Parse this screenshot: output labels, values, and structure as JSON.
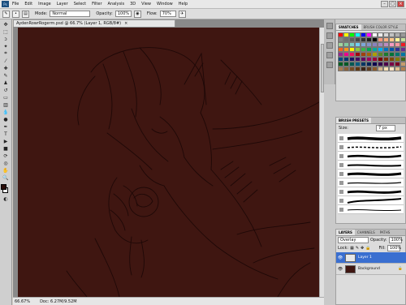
{
  "menu": {
    "app_icon": "Ps",
    "items": [
      "File",
      "Edit",
      "Image",
      "Layer",
      "Select",
      "Filter",
      "Analysis",
      "3D",
      "View",
      "Window",
      "Help"
    ]
  },
  "window_buttons": {
    "minimize": "–",
    "maximize": "▢",
    "close": "×"
  },
  "options_bar": {
    "mode_label": "Mode:",
    "mode_value": "Normal",
    "opacity_label": "Opacity:",
    "opacity_value": "100%",
    "flow_label": "Flow:",
    "flow_value": "70%"
  },
  "document": {
    "tab_title": "AydenRowrRogerm.psd @ 66.7% (Layer 1, RGB/8#)",
    "tab_close": "×",
    "zoom": "66.67%",
    "doc_info": "Doc: 6.27M/9.52M"
  },
  "colors": {
    "canvas_bg": "#3f1611",
    "sketch_line": "#1e0807",
    "foreground": "#2a0c08",
    "background": "#ffffff",
    "layer_highlight": "#3a6fd0"
  },
  "swatches_panel": {
    "tabs": [
      "SWATCHES",
      "BRUSH COLOR STYLE"
    ],
    "colors": [
      "#ff0000",
      "#ffff00",
      "#00ff00",
      "#00ffff",
      "#0000ff",
      "#ff00ff",
      "#ffffff",
      "#ebebeb",
      "#d6d6d6",
      "#c2c2c2",
      "#adadad",
      "#999999",
      "#858585",
      "#707070",
      "#5c5c5c",
      "#474747",
      "#333333",
      "#1f1f1f",
      "#000000",
      "#f7977a",
      "#f9ad81",
      "#fdc68a",
      "#fff79a",
      "#c4df9b",
      "#a2d39c",
      "#82ca9d",
      "#7bcdc8",
      "#6ecff6",
      "#7ea7d8",
      "#8493ca",
      "#8882be",
      "#a187be",
      "#bc8dbf",
      "#f49ac2",
      "#f6989d",
      "#ed1c24",
      "#f26522",
      "#f7941d",
      "#fff200",
      "#8dc63f",
      "#39b54a",
      "#00a651",
      "#00a99d",
      "#00aeef",
      "#0072bc",
      "#0054a6",
      "#2e3192",
      "#662d91",
      "#92278f",
      "#ec008c",
      "#ed145b",
      "#9e0b0f",
      "#a0410d",
      "#a3620a",
      "#aba000",
      "#598527",
      "#1a7b30",
      "#007236",
      "#00746b",
      "#0076a3",
      "#004a80",
      "#003471",
      "#1b1464",
      "#440e62",
      "#630460",
      "#9e005d",
      "#9e0039",
      "#790000",
      "#7b2e00",
      "#7d4900",
      "#827b00",
      "#406618",
      "#005e20",
      "#005826",
      "#005952",
      "#005b7f",
      "#003663",
      "#002157",
      "#0d004c",
      "#32004b",
      "#4b0049",
      "#7b0046",
      "#7a0026",
      "#c69c6d",
      "#a67c52",
      "#8c6239",
      "#754c24",
      "#603913",
      "#3c2415",
      "#5e3c1f",
      "#8b5a2b",
      "#d2b48c",
      "#f5deb3",
      "#ffe4c4",
      "#e0c090",
      "#b08050"
    ]
  },
  "brush_panel": {
    "tabs": [
      "BRUSH PRESETS"
    ],
    "size_label": "Size:",
    "size_value": "7 px"
  },
  "layers_panel": {
    "tabs": [
      "LAYERS",
      "CHANNELS",
      "PATHS"
    ],
    "blend_mode": "Overlay",
    "opacity_label": "Opacity:",
    "opacity_value": "100%",
    "lock_label": "Lock:",
    "fill_label": "Fill:",
    "fill_value": "100%",
    "layers": [
      {
        "name": "Layer 1",
        "selected": true
      },
      {
        "name": "Background",
        "selected": false,
        "locked": true
      }
    ]
  }
}
